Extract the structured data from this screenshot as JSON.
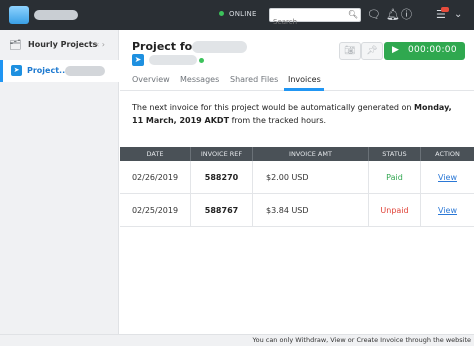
{
  "topbar": {
    "status": "ONLINE",
    "search_placeholder": "Search",
    "icons": [
      "search-icon",
      "chat-icon",
      "bell-icon",
      "help-icon",
      "menu-icon"
    ]
  },
  "sidebar": {
    "heading": "Hourly Projects",
    "prev_arrow": "‹",
    "next_arrow": "›",
    "active_item_label": "Project.."
  },
  "project": {
    "title": "Project for"
  },
  "timer": {
    "value": "000:00:00"
  },
  "tabs": [
    {
      "label": "Overview",
      "active": false
    },
    {
      "label": "Messages",
      "active": false
    },
    {
      "label": "Shared Files",
      "active": false
    },
    {
      "label": "Invoices",
      "active": true
    }
  ],
  "notice": {
    "prefix": "The next invoice for this project would be automatically generated on ",
    "date": "Monday, 11 March, 2019 AKDT",
    "suffix": " from the tracked hours."
  },
  "invoice_table": {
    "headers": [
      "DATE",
      "INVOICE REF",
      "INVOICE AMT",
      "STATUS",
      "ACTION"
    ],
    "rows": [
      {
        "date": "02/26/2019",
        "ref": "588270",
        "amount": "$2.00 USD",
        "status": "Paid",
        "action": "View"
      },
      {
        "date": "02/25/2019",
        "ref": "588767",
        "amount": "$3.84 USD",
        "status": "Unpaid",
        "action": "View"
      }
    ]
  },
  "footer": {
    "text": "You can only Withdraw, View or Create Invoice through the website"
  },
  "colors": {
    "topbar_bg": "#2a2f34",
    "accent": "#2196f3",
    "timer_green": "#2fa84f",
    "paid": "#34a853",
    "unpaid": "#e04338",
    "link": "#2b78d6"
  }
}
